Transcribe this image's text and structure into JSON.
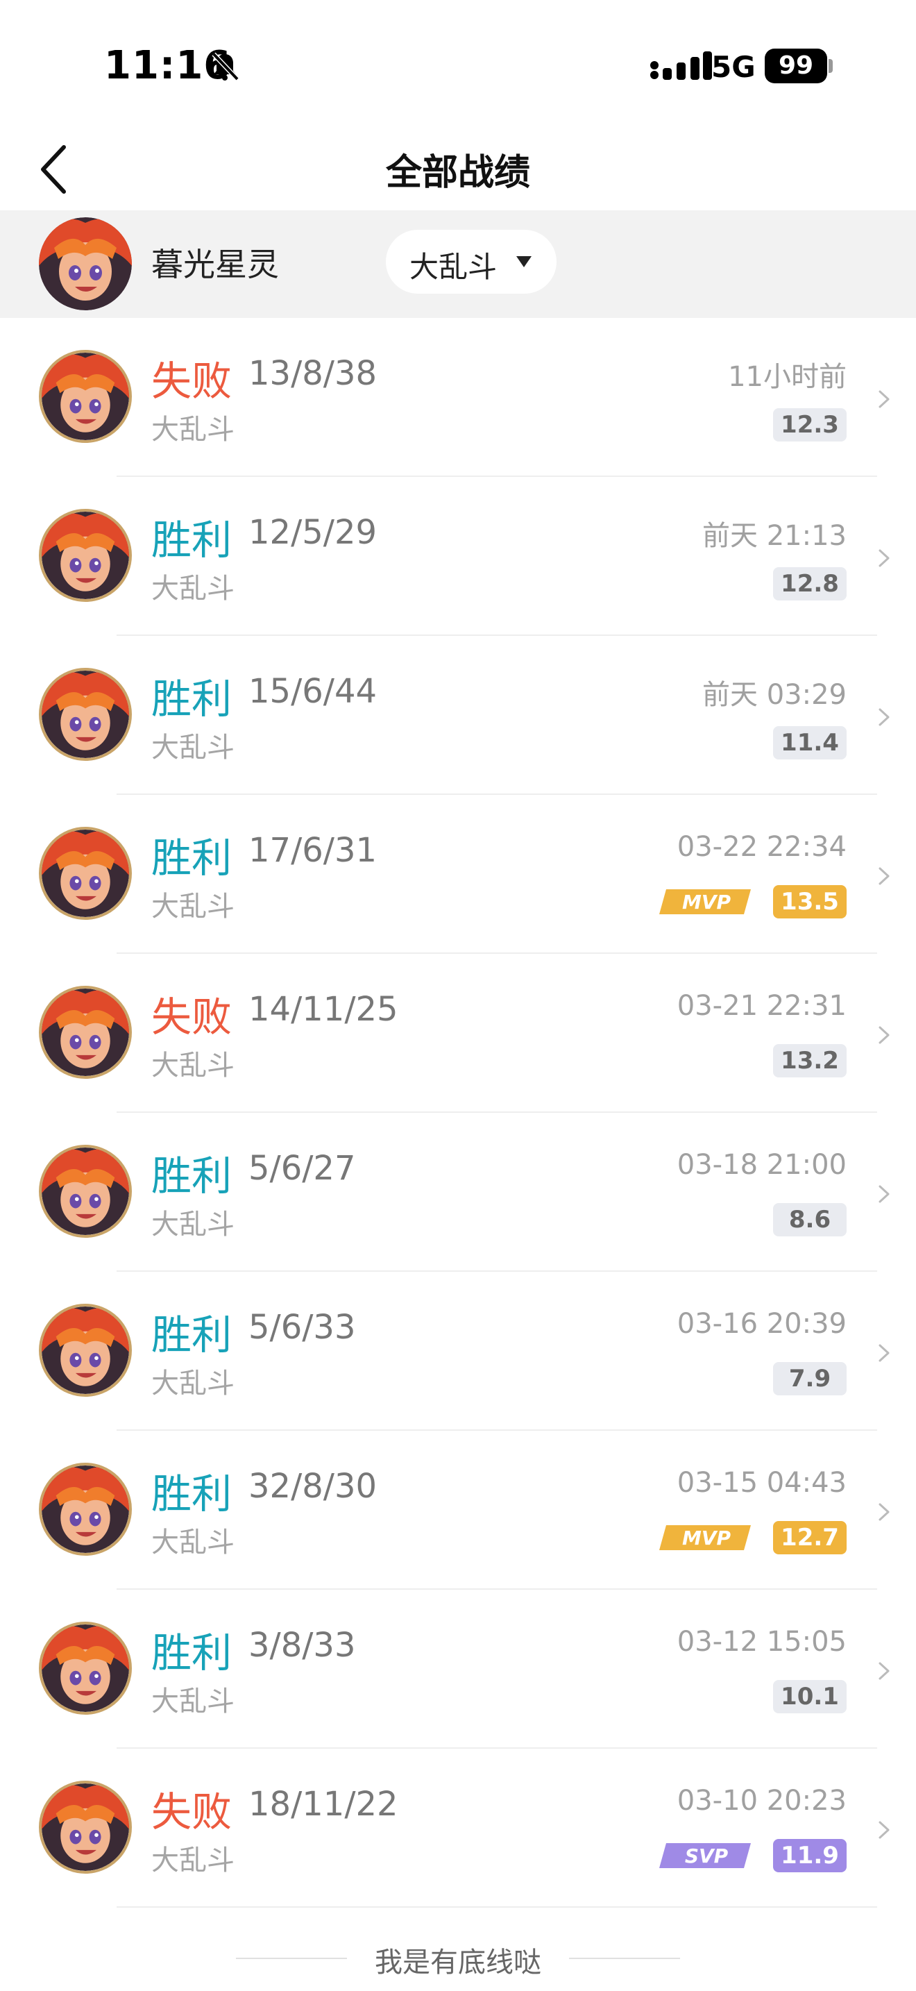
{
  "status_bar": {
    "time": "11:16",
    "network": "5G",
    "battery": "99"
  },
  "nav": {
    "title": "全部战绩"
  },
  "player": {
    "name": "暮光星灵",
    "mode_filter": "大乱斗"
  },
  "matches": [
    {
      "result": "失败",
      "outcome": "loss",
      "kda": "13/8/38",
      "mode": "大乱斗",
      "time": "11小时前",
      "score": "12.3",
      "badge": "normal",
      "award": ""
    },
    {
      "result": "胜利",
      "outcome": "win",
      "kda": "12/5/29",
      "mode": "大乱斗",
      "time": "前天 21:13",
      "score": "12.8",
      "badge": "normal",
      "award": ""
    },
    {
      "result": "胜利",
      "outcome": "win",
      "kda": "15/6/44",
      "mode": "大乱斗",
      "time": "前天 03:29",
      "score": "11.4",
      "badge": "normal",
      "award": ""
    },
    {
      "result": "胜利",
      "outcome": "win",
      "kda": "17/6/31",
      "mode": "大乱斗",
      "time": "03-22 22:34",
      "score": "13.5",
      "badge": "mvp",
      "award": "MVP"
    },
    {
      "result": "失败",
      "outcome": "loss",
      "kda": "14/11/25",
      "mode": "大乱斗",
      "time": "03-21 22:31",
      "score": "13.2",
      "badge": "normal",
      "award": ""
    },
    {
      "result": "胜利",
      "outcome": "win",
      "kda": "5/6/27",
      "mode": "大乱斗",
      "time": "03-18 21:00",
      "score": "8.6",
      "badge": "normal",
      "award": ""
    },
    {
      "result": "胜利",
      "outcome": "win",
      "kda": "5/6/33",
      "mode": "大乱斗",
      "time": "03-16 20:39",
      "score": "7.9",
      "badge": "normal",
      "award": ""
    },
    {
      "result": "胜利",
      "outcome": "win",
      "kda": "32/8/30",
      "mode": "大乱斗",
      "time": "03-15 04:43",
      "score": "12.7",
      "badge": "mvp",
      "award": "MVP"
    },
    {
      "result": "胜利",
      "outcome": "win",
      "kda": "3/8/33",
      "mode": "大乱斗",
      "time": "03-12 15:05",
      "score": "10.1",
      "badge": "normal",
      "award": ""
    },
    {
      "result": "失败",
      "outcome": "loss",
      "kda": "18/11/22",
      "mode": "大乱斗",
      "time": "03-10 20:23",
      "score": "11.9",
      "badge": "svp",
      "award": "SVP"
    }
  ],
  "footer": {
    "text": "我是有底线哒"
  },
  "colors": {
    "win": "#17a2b8",
    "loss": "#ec5a3e",
    "mvp": "#f0b43c",
    "svp": "#9f8ae6"
  },
  "icons": {
    "back": "chevron-left-icon",
    "bell_off": "bell-slash-icon",
    "signal": "cellular-signal-icon",
    "row_arrow": "chevron-right-icon",
    "award": "award-badge-icon",
    "avatar": "hero-portrait"
  }
}
